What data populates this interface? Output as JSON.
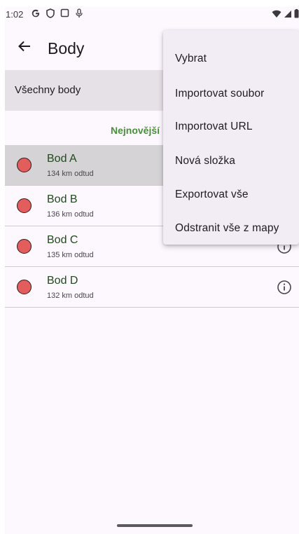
{
  "status_bar": {
    "time": "1:02",
    "icons_left": [
      "google-icon",
      "shield-icon",
      "screenshot-icon",
      "mic-off-icon"
    ],
    "icons_right": [
      "wifi-icon",
      "signal-icon",
      "battery-icon"
    ]
  },
  "app_bar": {
    "back_icon": "arrow-back-icon",
    "title": "Body"
  },
  "filter": {
    "label": "Všechny body"
  },
  "sort": {
    "label": "Nejnovější"
  },
  "points": [
    {
      "name": "Bod A",
      "distance": "134 km odtud",
      "selected": true
    },
    {
      "name": "Bod B",
      "distance": "136 km odtud",
      "selected": false
    },
    {
      "name": "Bod C",
      "distance": "135 km odtud",
      "selected": false
    },
    {
      "name": "Bod D",
      "distance": "132 km odtud",
      "selected": false
    }
  ],
  "menu": {
    "items": [
      "Vybrat",
      "Importovat soubor",
      "Importovat URL",
      "Nová složka",
      "Exportovat vše",
      "Odstranit vše z mapy"
    ]
  },
  "colors": {
    "background": "#fdf7fe",
    "accent_green": "#4a8f3c",
    "point_marker": "#e35d5d",
    "selected_row": "#d6d3d6",
    "menu_surface": "#f2ecf5"
  }
}
